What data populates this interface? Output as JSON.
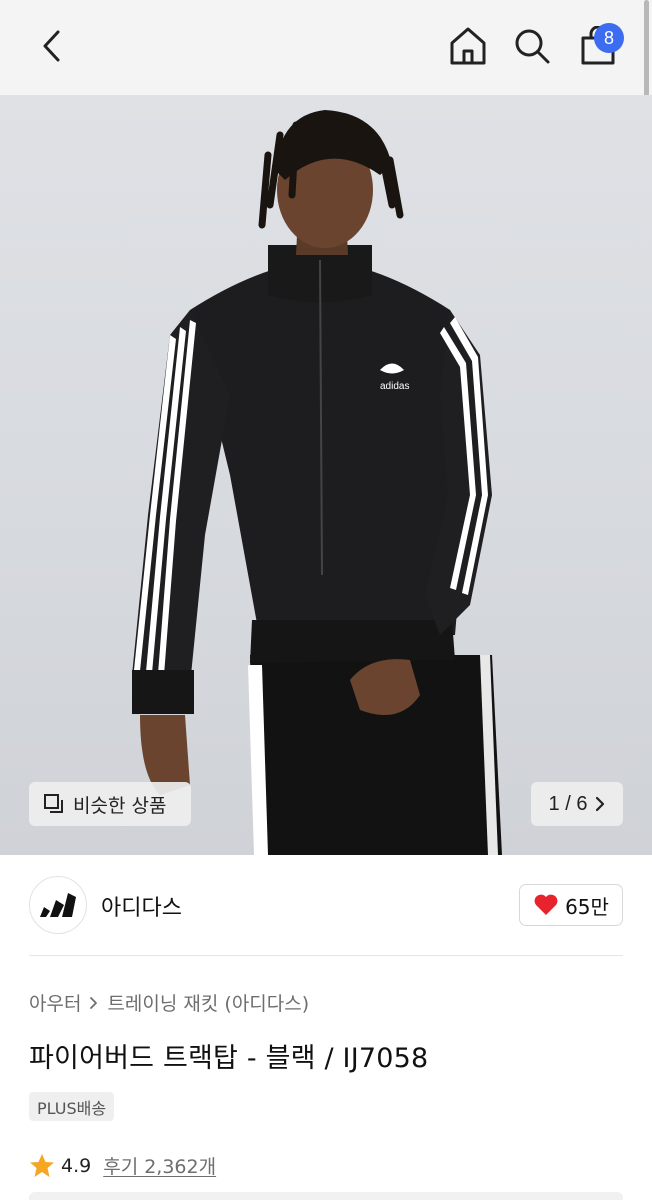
{
  "header": {
    "cart_count": "8"
  },
  "hero": {
    "similar_label": "비슷한 상품",
    "pager": "1 / 6",
    "garment_logo_text": "adidas"
  },
  "brand": {
    "name": "아디다스",
    "likes": "65만"
  },
  "product": {
    "breadcrumb": [
      "아우터",
      "트레이닝 재킷 (아디다스)"
    ],
    "title": "파이어버드 트랙탑 - 블랙 / IJ7058",
    "badge": "PLUS배송",
    "rating": "4.9",
    "reviews": "후기 2,362개"
  },
  "colors": {
    "accent_badge": "#3c6cf0",
    "heart": "#e8232d",
    "star": "#f5a623"
  },
  "icons": [
    "back-icon",
    "home-icon",
    "search-icon",
    "shopping-bag-icon",
    "similar-items-icon",
    "chevron-right-icon",
    "heart-icon",
    "star-icon",
    "adidas-logo"
  ]
}
